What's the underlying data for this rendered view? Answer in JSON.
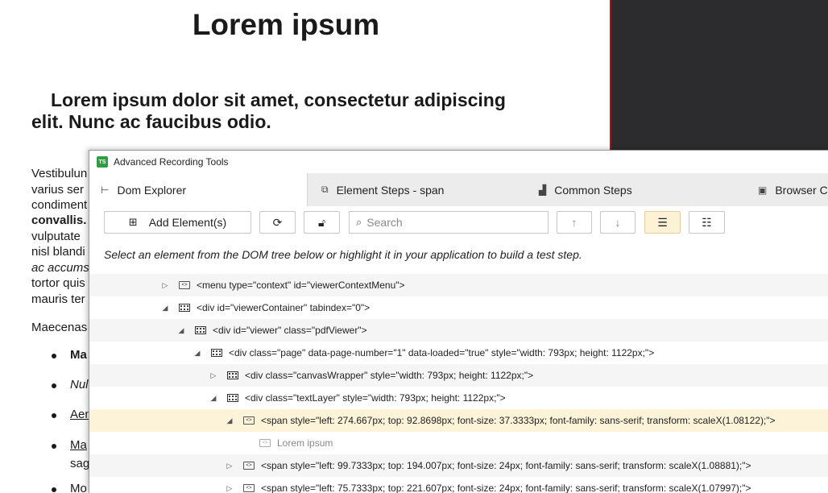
{
  "pdf": {
    "title": "Lorem ipsum",
    "subtitle_line1": "Lorem ipsum dolor sit amet, consectetur adipiscing",
    "subtitle_line2": "elit. Nunc ac faucibus odio.",
    "lines": [
      "Vestibulun",
      "varius ser",
      "condiment",
      "convallis.",
      "vulputate",
      "nisl blandi",
      "ac accums",
      "tortor quis",
      "mauris ter"
    ],
    "para2": "Maecenas",
    "bullets": [
      "Ma",
      "Nul",
      "Aen",
      "Ma",
      "sag",
      "Mo"
    ]
  },
  "panel": {
    "title": "Advanced Recording Tools",
    "logo": "TS",
    "tabs": [
      {
        "label": "Dom Explorer",
        "icon": "tree-icon"
      },
      {
        "label": "Element Steps - span",
        "icon": "steps-icon"
      },
      {
        "label": "Common Steps",
        "icon": "bars-icon"
      },
      {
        "label": "Browser C",
        "icon": "browser-icon"
      }
    ],
    "toolbar": {
      "add_label": "Add Element(s)",
      "search_placeholder": "Search"
    },
    "hint": "Select an element from the DOM tree below or highlight it in your application to build a test step.",
    "tree": [
      {
        "text": "<menu type=\"context\" id=\"viewerContextMenu\">",
        "expander": "▷",
        "icon": "code"
      },
      {
        "text": "<div id=\"viewerContainer\" tabindex=\"0\">",
        "expander": "◢",
        "icon": "grid"
      },
      {
        "text": "<div id=\"viewer\" class=\"pdfViewer\">",
        "expander": "◢",
        "icon": "grid"
      },
      {
        "text": "<div class=\"page\" data-page-number=\"1\" data-loaded=\"true\" style=\"width: 793px; height: 1122px;\">",
        "expander": "◢",
        "icon": "grid"
      },
      {
        "text": "<div class=\"canvasWrapper\" style=\"width: 793px; height: 1122px;\">",
        "expander": "▷",
        "icon": "grid"
      },
      {
        "text": "<div class=\"textLayer\" style=\"width: 793px; height: 1122px;\">",
        "expander": "◢",
        "icon": "grid"
      },
      {
        "text": "<span style=\"left: 274.667px; top: 92.8698px; font-size: 37.3333px; font-family: sans-serif; transform: scaleX(1.08122);\">",
        "expander": "◢",
        "icon": "code"
      },
      {
        "text": "Lorem ipsum",
        "expander": "",
        "icon": "code"
      },
      {
        "text": "<span style=\"left: 99.7333px; top: 194.007px; font-size: 24px; font-family: sans-serif; transform: scaleX(1.08881);\">",
        "expander": "▷",
        "icon": "code"
      },
      {
        "text": "<span style=\"left: 75.7333px; top: 221.607px; font-size: 24px; font-family: sans-serif; transform: scaleX(1.07997);\">",
        "expander": "▷",
        "icon": "code"
      }
    ]
  }
}
